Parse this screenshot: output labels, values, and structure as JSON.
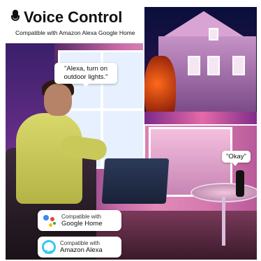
{
  "header": {
    "title": "Voice Control",
    "subtitle": "Compatible with Amazon Alexa Google Home"
  },
  "bubbles": {
    "alexa_command": "\"Alexa, turn on outdoor lights.\"",
    "okay_reply": "\"Okay\""
  },
  "badges": {
    "google": {
      "line1": "Compatible with",
      "line2": "Google Home"
    },
    "amazon": {
      "line1": "Compatible with",
      "line2": "Amazon Alexa"
    }
  },
  "colors": {
    "google_blue": "#4285F4",
    "google_red": "#EA4335",
    "google_yellow": "#FBBC05",
    "google_green": "#34A853",
    "alexa_cyan": "#35C6F2"
  },
  "icons": [
    "microphone-icon",
    "google-assistant-icon",
    "alexa-icon"
  ]
}
